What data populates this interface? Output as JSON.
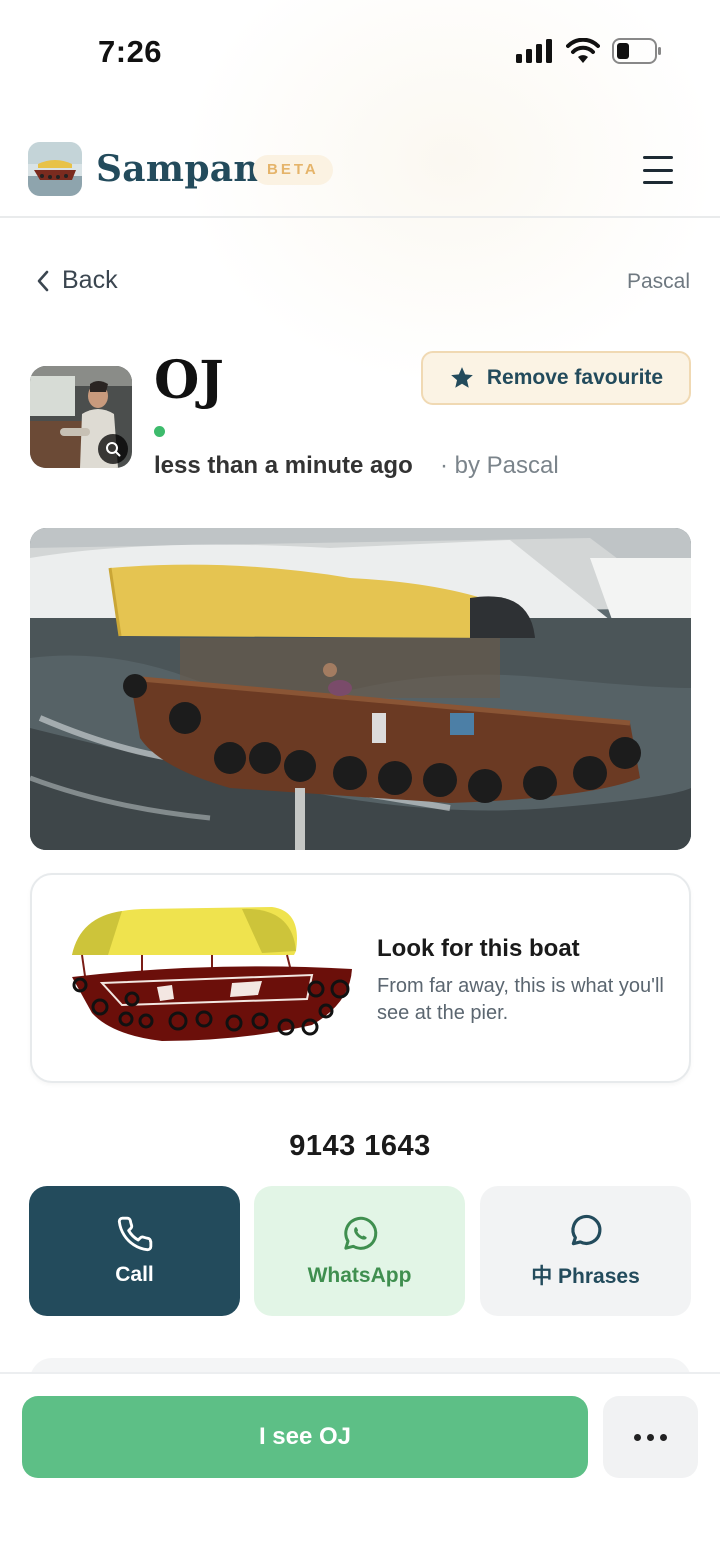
{
  "status_bar": {
    "time": "7:26"
  },
  "header": {
    "app_name": "Sampan",
    "badge": "BETA"
  },
  "nav": {
    "back_label": "Back",
    "owner_link": "Pascal"
  },
  "boat": {
    "name": "OJ",
    "last_seen": "less than a minute ago",
    "by_line": "· by Pascal",
    "favourite_label": "Remove favourite"
  },
  "look_card": {
    "title": "Look for this boat",
    "description": "From far away, this is what you'll see at the pier."
  },
  "contact": {
    "phone": "9143 1643",
    "call_label": "Call",
    "whatsapp_label": "WhatsApp",
    "phrases_label": "中 Phrases"
  },
  "bottom": {
    "see_label": "I see OJ"
  },
  "colors": {
    "brand": "#234b5c",
    "accent_green": "#5dbf86",
    "beta_bg": "#fbf2e2",
    "favourite_bg": "#fbf3e4",
    "whatsapp_bg": "#e2f5e6",
    "online": "#3dbb6c"
  }
}
